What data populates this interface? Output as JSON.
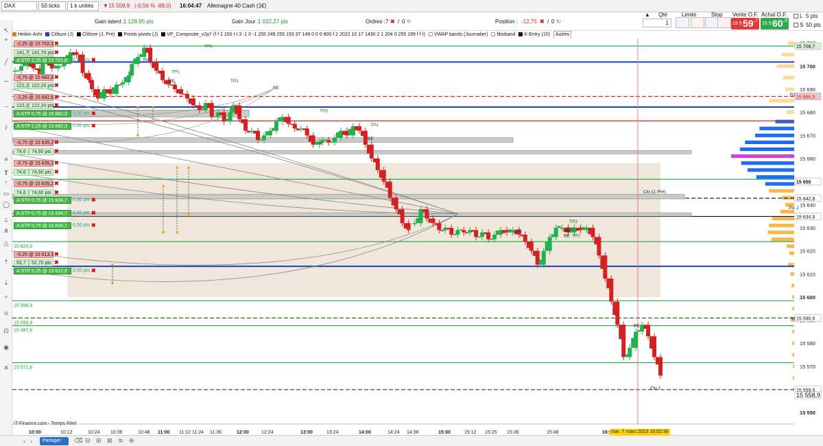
{
  "topbar": {
    "symbol": "DAX",
    "period": "50 ticks",
    "units": "1 k unités",
    "quote_price": "15 559,9",
    "quote_change": "(-0,56 % -88,0)",
    "quote_time": "16:04:47",
    "instrument": "Allemagne 40 Cash (1€)"
  },
  "infobar": {
    "gain_latent_label": "Gain latent :",
    "gain_latent_value": "1 129,95 pts",
    "gain_jour_label": "Gain Jour :",
    "gain_jour_value": "1 032,27 pts",
    "ordres_label": "Ordres :",
    "ordres_value": "7",
    "ordres_zero": "0",
    "position_label": "Position :",
    "position_value": "-12,75",
    "position_zero": "0",
    "qty_label": "Qté",
    "qty_value": "1",
    "limit_label": "Limite",
    "stop_label": "Stop",
    "sell_label": "Vente O.F.",
    "sell_prefix": "15 5",
    "sell_big": "59",
    "sell_sup": ",7",
    "buy_label": "Achat O.F.",
    "buy_prefix": "15 5",
    "buy_big": "60",
    "buy_sup": ",9",
    "l_label": "L",
    "l_value": "5 pts",
    "s_label": "S",
    "s_value": "50 pts"
  },
  "indicators": [
    {
      "label": "Heikin-Ashi",
      "color": "#e67e22"
    },
    {
      "label": "Clôture (J)",
      "color": "#1f3fbf"
    },
    {
      "label": "Clôture (J, Pré)",
      "color": "#111111"
    },
    {
      "label": "Points pivots (J)",
      "color": "#111111"
    },
    {
      "label": "VP_Composite_v2p7 (f f 2 150 t t 3 -1 0 -1 255 249 255 193 37 149 0 0 0 800 f 2 2022 10 17 1430 2 1 204 0 255 199 f f t)",
      "color": "#111111"
    },
    {
      "label": "VWAP bands (Journalier)",
      "color": "#ffffff"
    },
    {
      "label": "fiboband",
      "color": "#ffffff"
    },
    {
      "label": "K-Entry (10)",
      "color": "#111111"
    },
    {
      "label": "Autres",
      "color": ""
    }
  ],
  "orders": [
    {
      "text": "-2,25 @ 15 702,3",
      "kind": "red"
    },
    {
      "text": "141,7",
      "kind": "val"
    },
    {
      "text": "141,70 pts",
      "kind": "pts"
    },
    {
      "text": "A:STP 2,25 @ 15 701,8",
      "kind": "grn"
    },
    {
      "text": "0,50 pts",
      "kind": "small"
    },
    {
      "text": "-0,75 @ 15 682,8",
      "kind": "red"
    },
    {
      "text": "122,2",
      "kind": "val"
    },
    {
      "text": "122,20 pts",
      "kind": "pts"
    },
    {
      "text": "-2,25 @ 15 682,8",
      "kind": "red"
    },
    {
      "text": "122,2",
      "kind": "val"
    },
    {
      "text": "122,20 pts",
      "kind": "pts"
    },
    {
      "text": "A:STP 0,75 @ 15 682,3",
      "kind": "grn"
    },
    {
      "text": "0,50 pts",
      "kind": "small"
    },
    {
      "text": "A:STP 2,25 @ 15 682,3",
      "kind": "grn"
    },
    {
      "text": "0,50 pts",
      "kind": "small"
    },
    {
      "text": "-0,75 @ 15 635,2",
      "kind": "red"
    },
    {
      "text": "74,6",
      "kind": "val"
    },
    {
      "text": "74,60 pts",
      "kind": "pts"
    },
    {
      "text": "-0,75 @ 15 635,2",
      "kind": "red"
    },
    {
      "text": "74,6",
      "kind": "val"
    },
    {
      "text": "74,60 pts",
      "kind": "pts"
    },
    {
      "text": "-0,75 @ 15 635,2",
      "kind": "red"
    },
    {
      "text": "74,6",
      "kind": "val"
    },
    {
      "text": "74,60 pts",
      "kind": "pts"
    },
    {
      "text": "A:STP 0,75 @ 15 634,7",
      "kind": "grn"
    },
    {
      "text": "0,50 pts",
      "kind": "small"
    },
    {
      "text": "A:STP 0,75 @ 15 634,7",
      "kind": "grn"
    },
    {
      "text": "0,50 pts",
      "kind": "small"
    },
    {
      "text": "A:STP 0,75 @ 15 634,7",
      "kind": "grn"
    },
    {
      "text": "0,50 pts",
      "kind": "small"
    },
    {
      "text": "-5,25 @ 15 613,3",
      "kind": "red"
    },
    {
      "text": "52,7",
      "kind": "val"
    },
    {
      "text": "52,70 pts",
      "kind": "pts"
    },
    {
      "text": "A:STP 5,25 @ 15 612,8",
      "kind": "grn"
    },
    {
      "text": "0,50 pts",
      "kind": "small"
    }
  ],
  "footer": {
    "source": "IT-Finance.com - Temps Réel",
    "share": "Partager",
    "cursor_date": "mar. 7 mars 2023 16:02:30"
  },
  "chart_data": {
    "type": "line",
    "title": "",
    "xlabel": "",
    "ylabel": "",
    "ylim": [
      15545,
      15712
    ],
    "yticks": [
      15550,
      15560,
      15570,
      15580,
      15590,
      15600,
      15610,
      15620,
      15630,
      15640,
      15650,
      15660,
      15670,
      15680,
      15690,
      15700,
      15710
    ],
    "x_ticks": [
      {
        "label": "10:00",
        "bold": true
      },
      {
        "label": "10:12",
        "bold": false
      },
      {
        "label": "10:24",
        "bold": false
      },
      {
        "label": "10:36",
        "bold": false
      },
      {
        "label": "10:48",
        "bold": false
      },
      {
        "label": "11:00",
        "bold": true
      },
      {
        "label": "11:12",
        "bold": false
      },
      {
        "label": "11:24",
        "bold": false
      },
      {
        "label": "11:36",
        "bold": false
      },
      {
        "label": "12:00",
        "bold": true
      },
      {
        "label": "12:24",
        "bold": false
      },
      {
        "label": "13:00",
        "bold": true
      },
      {
        "label": "13:24",
        "bold": false
      },
      {
        "label": "14:00",
        "bold": true
      },
      {
        "label": "14:24",
        "bold": false
      },
      {
        "label": "14:36",
        "bold": false
      },
      {
        "label": "15:00",
        "bold": true
      },
      {
        "label": "15:12",
        "bold": false
      },
      {
        "label": "15:25",
        "bold": false
      },
      {
        "label": "15:36",
        "bold": false
      },
      {
        "label": "15:48",
        "bold": false
      },
      {
        "label": "16:00",
        "bold": true
      }
    ],
    "series": [
      {
        "x": [
          0,
          4,
          8,
          12,
          16,
          18,
          20,
          24,
          28,
          32,
          36,
          40,
          44,
          48,
          50,
          54,
          58,
          62,
          66,
          70,
          74,
          76,
          80,
          84,
          88,
          92,
          96,
          100,
          104,
          108,
          112,
          116,
          120,
          124,
          128,
          132,
          136,
          140,
          142,
          146,
          150,
          154,
          158,
          162,
          166,
          170,
          174,
          178,
          182,
          186,
          190,
          194,
          198,
          200,
          204,
          208,
          212,
          216,
          220,
          224,
          228,
          232,
          236,
          240,
          244,
          248,
          252,
          256
        ],
        "close": [
          15698,
          15700,
          15702,
          15699,
          15696,
          15702,
          15703,
          15699,
          15700,
          15702,
          15706,
          15705,
          15697,
          15694,
          15690,
          15686,
          15690,
          15688,
          15692,
          15693,
          15696,
          15701,
          15704,
          15708,
          15702,
          15698,
          15694,
          15692,
          15690,
          15688,
          15686,
          15683,
          15681,
          15684,
          15678,
          15680,
          15676,
          15680,
          15683,
          15677,
          15672,
          15672,
          15668,
          15670,
          15672,
          15676,
          15678,
          15675,
          15673,
          15673,
          15670,
          15666,
          15667,
          15668,
          15667,
          15669,
          15672,
          15670,
          15674,
          15672,
          15666,
          15660,
          15655,
          15650,
          15643,
          15638,
          15632,
          15629
        ]
      },
      {
        "x": [
          260,
          264,
          268,
          272,
          276,
          280,
          284,
          288,
          292,
          296,
          300,
          304,
          308,
          312,
          316,
          320,
          324,
          328,
          332,
          336,
          340,
          344,
          348,
          352,
          356,
          360,
          364,
          368,
          372,
          376,
          380,
          384,
          388,
          392,
          396,
          400,
          404,
          408,
          412,
          416,
          420
        ],
        "close": [
          15632,
          15638,
          15634,
          15632,
          15629,
          15630,
          15627,
          15629,
          15628,
          15629,
          15626,
          15628,
          15625,
          15627,
          15629,
          15628,
          15629,
          15627,
          15624,
          15620,
          15614,
          15620,
          15626,
          15630,
          15630,
          15628,
          15630,
          15629,
          15630,
          15626,
          15618,
          15608,
          15598,
          15588,
          15574,
          15578,
          15585,
          15588,
          15583,
          15574,
          15566
        ]
      }
    ],
    "horizontal_levels": [
      {
        "value": 15708.7,
        "color": "#22b14c",
        "style": "solid",
        "label": "15 708,7"
      },
      {
        "value": 15701.8,
        "color": "#1f3fbf",
        "style": "solid",
        "label": ""
      },
      {
        "value": 15686.9,
        "color": "#d32020",
        "style": "dashed",
        "label": "15 686,9"
      },
      {
        "value": 15682.3,
        "color": "#1f3fbf",
        "style": "solid",
        "label": ""
      },
      {
        "value": 15676.3,
        "color": "#d32020",
        "style": "solid",
        "label": ""
      },
      {
        "value": 15651.0,
        "color": "#22b14c",
        "style": "solid",
        "label": "15 650"
      },
      {
        "value": 15642.8,
        "color": "#222222",
        "style": "dashed",
        "label": "15 642,8"
      },
      {
        "value": 15634.9,
        "color": "#111111",
        "style": "solid",
        "label": "15 634,9"
      },
      {
        "value": 15624.0,
        "color": "#22b14c",
        "style": "solid",
        "label": "15 624,0"
      },
      {
        "value": 15613.3,
        "color": "#1f3fbf",
        "style": "solid",
        "label": ""
      },
      {
        "value": 15598.4,
        "color": "#22b14c",
        "style": "solid",
        "label": "15 598,4"
      },
      {
        "value": 15590.9,
        "color": "#1d6b1d",
        "style": "dashed",
        "label": "15 590,9"
      },
      {
        "value": 15587.6,
        "color": "#22b14c",
        "style": "solid",
        "label": "15 587,6"
      },
      {
        "value": 15571.6,
        "color": "#22b14c",
        "style": "solid",
        "label": "15 571,6"
      },
      {
        "value": 15559.9,
        "color": "#3b3bbf",
        "style": "dashed",
        "label": "15 559,9"
      }
    ],
    "annotations": [
      "TP2",
      "BE",
      "TP1",
      "TP2",
      "TP1",
      "BE",
      "TP3",
      "BE",
      "TP1",
      "BE",
      "BE",
      "TP3",
      "TP2",
      "BE",
      "BE",
      "TP2",
      "Clo (J, Pré)",
      "Piv J",
      "S1 J",
      "R1 J",
      "Clo J"
    ],
    "right_tags": [
      "15 708,7",
      "15 686,9",
      "15 650",
      "15 642,8",
      "15 634,9",
      "15 590,9",
      "15 559,9",
      "15 558,9"
    ],
    "volume_profile_bins": [
      {
        "price": 15710,
        "volume": 10
      },
      {
        "price": 15705,
        "volume": 20
      },
      {
        "price": 15700,
        "volume": 28
      },
      {
        "price": 15695,
        "volume": 18
      },
      {
        "price": 15690,
        "volume": 14
      },
      {
        "price": 15685,
        "volume": 40
      },
      {
        "price": 15680,
        "volume": 12
      },
      {
        "price": 15676,
        "volume": 30
      },
      {
        "price": 15673,
        "volume": 55
      },
      {
        "price": 15670,
        "volume": 62
      },
      {
        "price": 15667,
        "volume": 78
      },
      {
        "price": 15664,
        "volume": 86
      },
      {
        "price": 15661,
        "volume": 100
      },
      {
        "price": 15658,
        "volume": 84
      },
      {
        "price": 15655,
        "volume": 74
      },
      {
        "price": 15652,
        "volume": 60
      },
      {
        "price": 15649,
        "volume": 46
      },
      {
        "price": 15646,
        "volume": 40
      },
      {
        "price": 15643,
        "volume": 20
      },
      {
        "price": 15640,
        "volume": 14
      },
      {
        "price": 15637,
        "volume": 22
      },
      {
        "price": 15634,
        "volume": 35
      },
      {
        "price": 15631,
        "volume": 40
      },
      {
        "price": 15628,
        "volume": 42
      },
      {
        "price": 15625,
        "volume": 36
      },
      {
        "price": 15622,
        "volume": 12
      },
      {
        "price": 15619,
        "volume": 8
      },
      {
        "price": 15614,
        "volume": 10
      },
      {
        "price": 15610,
        "volume": 6
      },
      {
        "price": 15605,
        "volume": 4
      },
      {
        "price": 15600,
        "volume": 3
      },
      {
        "price": 15595,
        "volume": 3
      },
      {
        "price": 15590,
        "volume": 4
      },
      {
        "price": 15585,
        "volume": 3
      },
      {
        "price": 15580,
        "volume": 3
      },
      {
        "price": 15575,
        "volume": 3
      },
      {
        "price": 15570,
        "volume": 2
      },
      {
        "price": 15565,
        "volume": 2
      },
      {
        "price": 15560,
        "volume": 2
      }
    ],
    "colors": {
      "up": "#22b14c",
      "down": "#d32020",
      "zone_fill": "#efe6dc",
      "profile": "#1c6cf5",
      "profile_poc": "#d042d6",
      "profile_low": "#f7b84b"
    }
  }
}
